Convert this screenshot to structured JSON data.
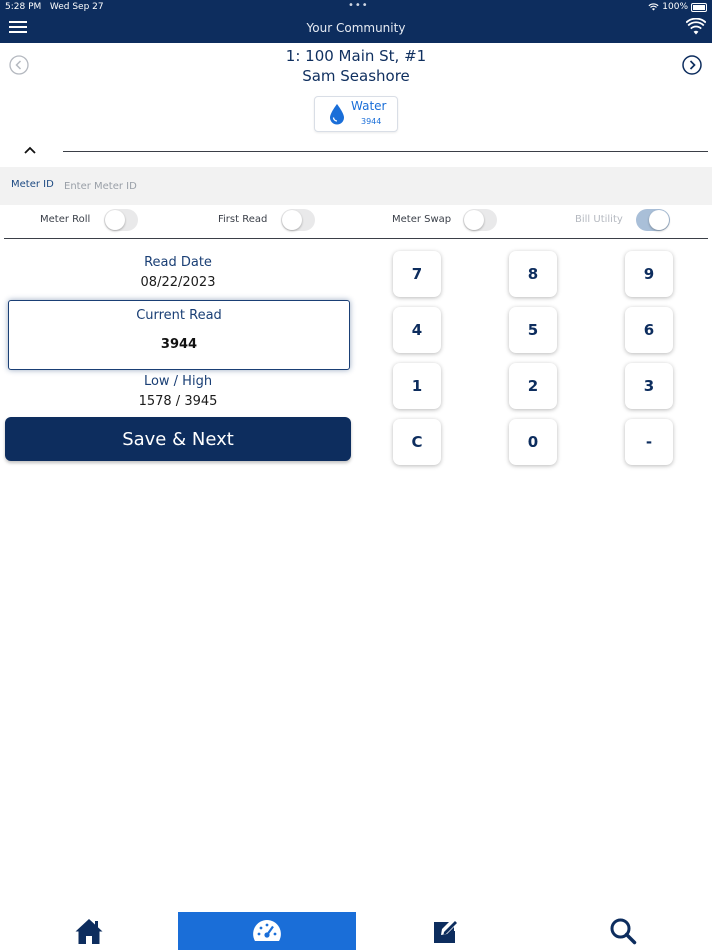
{
  "status_bar": {
    "time": "5:28 PM",
    "date": "Wed Sep 27",
    "battery": "100%"
  },
  "app": {
    "title": "Your Community"
  },
  "header": {
    "account": "1: 100 Main St, #1",
    "resident": "Sam Seashore"
  },
  "utility_tab": {
    "label": "Water",
    "value": "3944",
    "icon": "water-drop-icon"
  },
  "meter": {
    "label": "Meter ID",
    "placeholder": "Enter Meter ID",
    "value": ""
  },
  "toggles": [
    {
      "label": "Meter Roll",
      "on": false,
      "disabled": false
    },
    {
      "label": "First Read",
      "on": false,
      "disabled": false
    },
    {
      "label": "Meter Swap",
      "on": false,
      "disabled": false
    },
    {
      "label": "Bill Utility",
      "on": true,
      "disabled": true
    }
  ],
  "read": {
    "date_label": "Read Date",
    "date_value": "08/22/2023",
    "current_label": "Current Read",
    "current_value": "3944",
    "lowhigh_label": "Low / High",
    "lowhigh_value": "1578 / 3945"
  },
  "save_button": "Save & Next",
  "keypad": [
    "7",
    "8",
    "9",
    "4",
    "5",
    "6",
    "1",
    "2",
    "3",
    "C",
    "0",
    "-"
  ],
  "bottom_nav": [
    {
      "name": "home",
      "icon": "home-icon",
      "active": false
    },
    {
      "name": "meter-reading",
      "icon": "speedometer-icon",
      "active": true
    },
    {
      "name": "edit",
      "icon": "edit-icon",
      "active": false
    },
    {
      "name": "search",
      "icon": "search-icon",
      "active": false
    }
  ],
  "colors": {
    "navy": "#0d2d5e",
    "accent_blue": "#1a6ed8",
    "row_bg": "#f2f2f2"
  }
}
